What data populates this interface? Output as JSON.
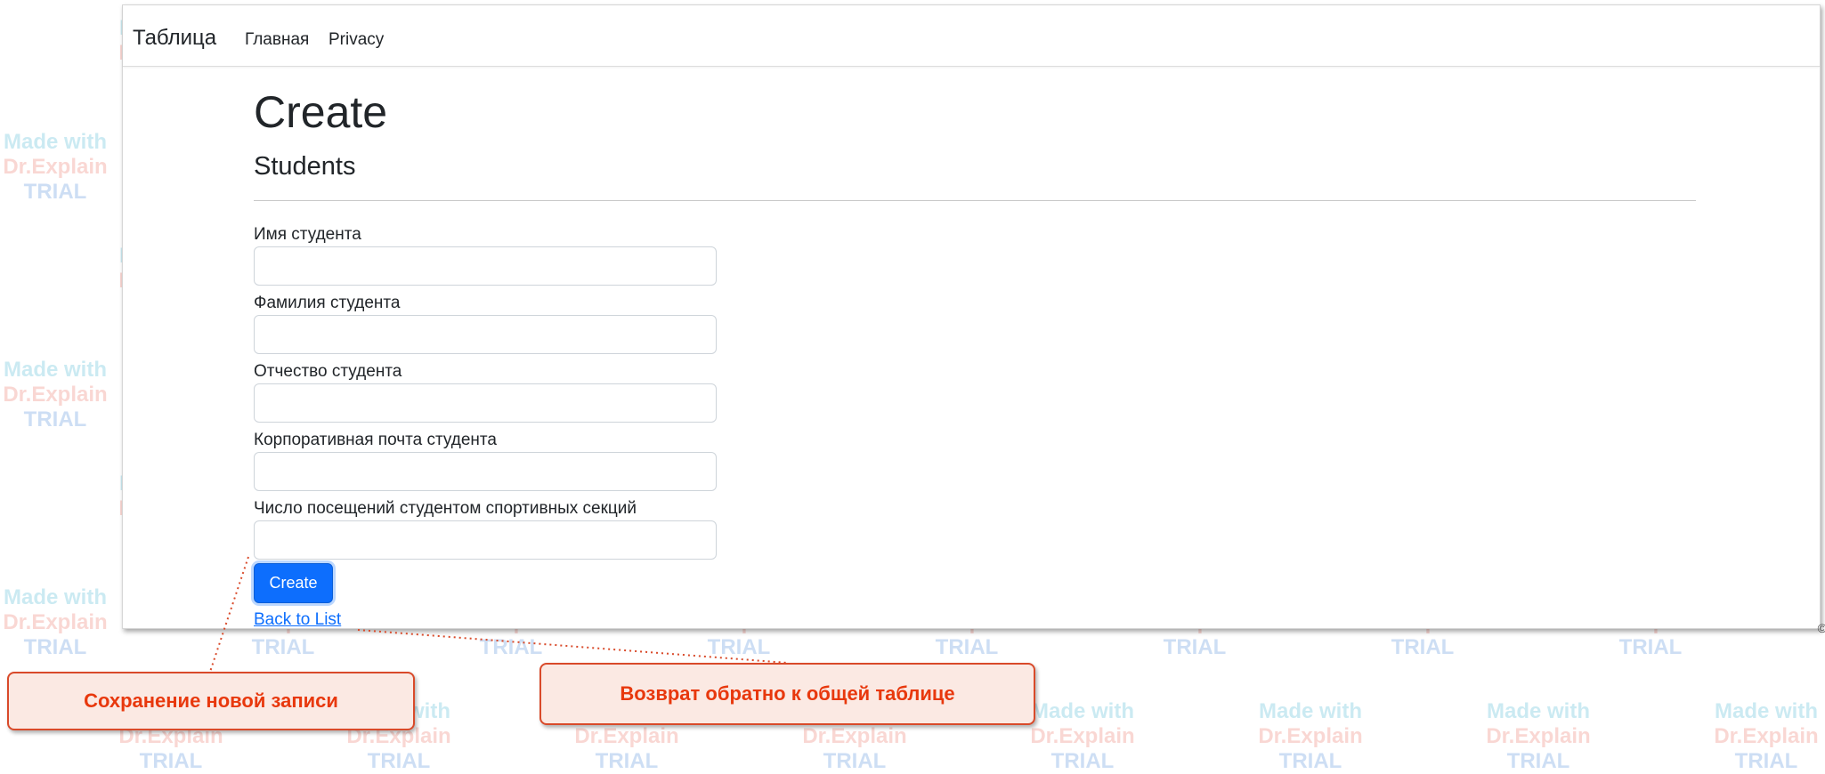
{
  "watermark": {
    "line1": "Made with",
    "line2": "Dr.Explain",
    "line3": "TRIAL"
  },
  "navbar": {
    "brand": "Таблица",
    "links": [
      {
        "label": "Главная"
      },
      {
        "label": "Privacy"
      }
    ]
  },
  "page": {
    "title": "Create",
    "subtitle": "Students"
  },
  "form": {
    "fields": [
      {
        "label": "Имя студента",
        "value": ""
      },
      {
        "label": "Фамилия студента",
        "value": ""
      },
      {
        "label": "Отчество студента",
        "value": ""
      },
      {
        "label": "Корпоративная почта студента",
        "value": ""
      },
      {
        "label": "Число посещений студентом спортивных секций",
        "value": ""
      }
    ],
    "submit_label": "Create",
    "back_link": "Back to List"
  },
  "corner_text": "©",
  "callouts": {
    "save": "Сохранение новой записи",
    "back": "Возврат обратно к общей таблице"
  },
  "colors": {
    "primary": "#0d6efd",
    "callout_text": "#e8380d",
    "callout_border": "#d94a2a",
    "callout_fill": "#fbe9e3"
  }
}
